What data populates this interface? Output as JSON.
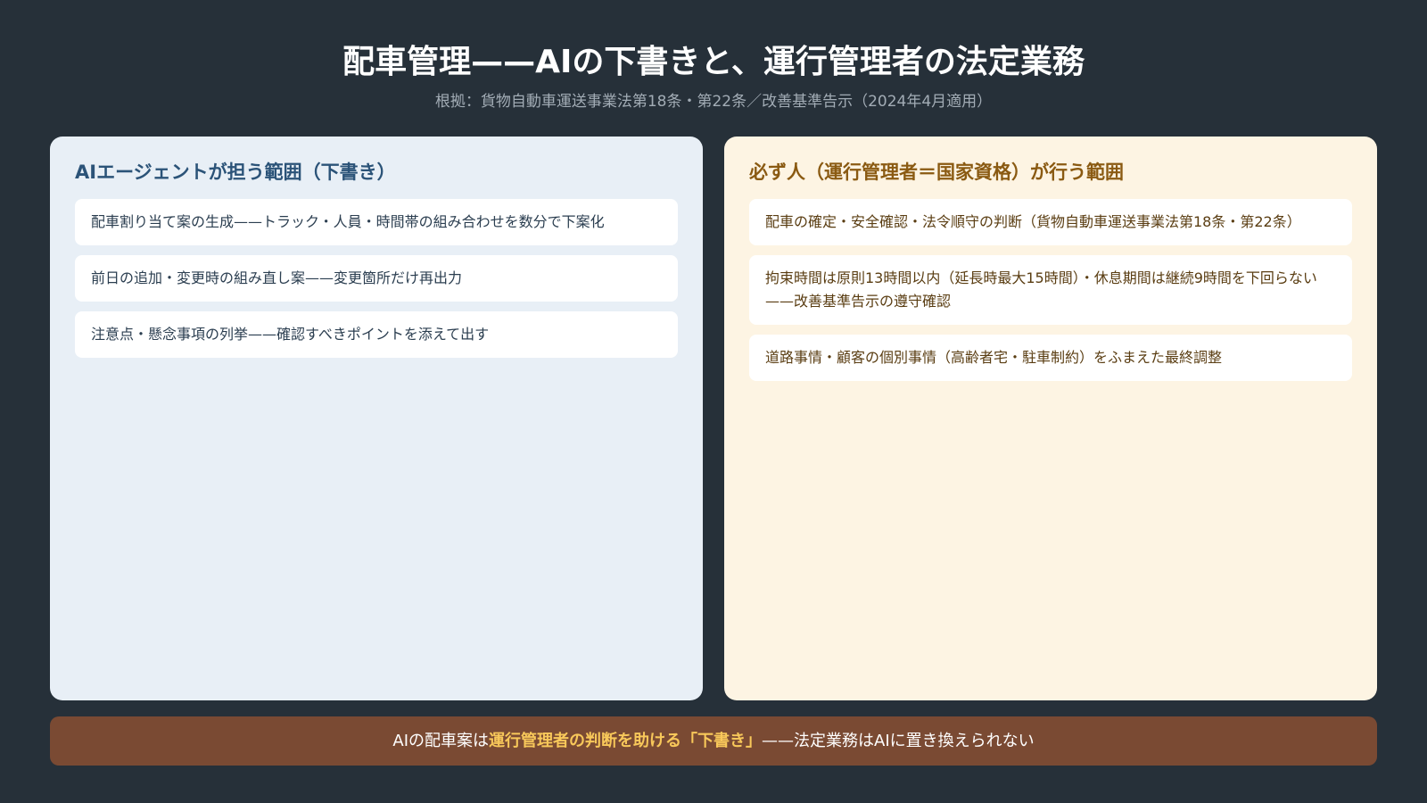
{
  "header": {
    "title": "配車管理——AIの下書きと、運行管理者の法定業務",
    "subtitle": "根拠：貨物自動車運送事業法第18条・第22条／改善基準告示（2024年4月適用）"
  },
  "left_panel": {
    "heading": "AIエージェントが担う範囲（下書き）",
    "items": [
      "配車割り当て案の生成——トラック・人員・時間帯の組み合わせを数分で下案化",
      "前日の追加・変更時の組み直し案——変更箇所だけ再出力",
      "注意点・懸念事項の列挙——確認すべきポイントを添えて出す"
    ]
  },
  "right_panel": {
    "heading": "必ず人（運行管理者＝国家資格）が行う範囲",
    "items": [
      "配車の確定・安全確認・法令順守の判断（貨物自動車運送事業法第18条・第22条）",
      "拘束時間は原則13時間以内（延長時最大15時間）・休息期間は継続9時間を下回らない——改善基準告示の遵守確認",
      "道路事情・顧客の個別事情（高齢者宅・駐車制約）をふまえた最終調整"
    ]
  },
  "banner": {
    "prefix": "AIの配車案は",
    "highlight": "運行管理者の判断を助ける「下書き」",
    "suffix": "——法定業務はAIに置き換えられない"
  },
  "colors": {
    "background": "#263039",
    "left_panel_bg": "#e8eff6",
    "right_panel_bg": "#fdf4e3",
    "left_heading": "#2b5378",
    "right_heading": "#8a5a12",
    "banner_bg": "#7a4a33",
    "banner_highlight": "#f8c85a"
  }
}
